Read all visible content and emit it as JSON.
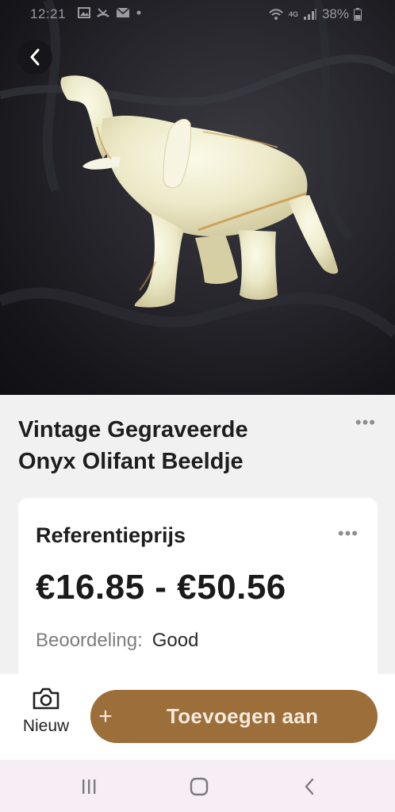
{
  "status_bar": {
    "time": "12:21",
    "left_icons": [
      "gallery-icon",
      "missed-call-icon",
      "mail-icon",
      "dot-icon"
    ],
    "right_icons": [
      "wifi-icon",
      "4g-icon",
      "signal-icon"
    ],
    "network": "4G",
    "battery": "38%"
  },
  "hero": {
    "back_icon": "chevron-left-icon"
  },
  "product": {
    "title": "Vintage Gegraveerde Onyx Olifant Beeldje",
    "more": "•••"
  },
  "price_card": {
    "heading": "Referentieprijs",
    "more": "•••",
    "price_range": "€16.85 - €50.56",
    "rating_label": "Beoordeling:",
    "rating_value": "Good"
  },
  "actions": {
    "camera_label": "Nieuw",
    "add_plus": "+",
    "add_label": "Toevoegen aan",
    "accent_color": "#9b6e3a"
  },
  "nav": {
    "icons": [
      "recent-apps-icon",
      "home-icon",
      "back-icon"
    ]
  }
}
